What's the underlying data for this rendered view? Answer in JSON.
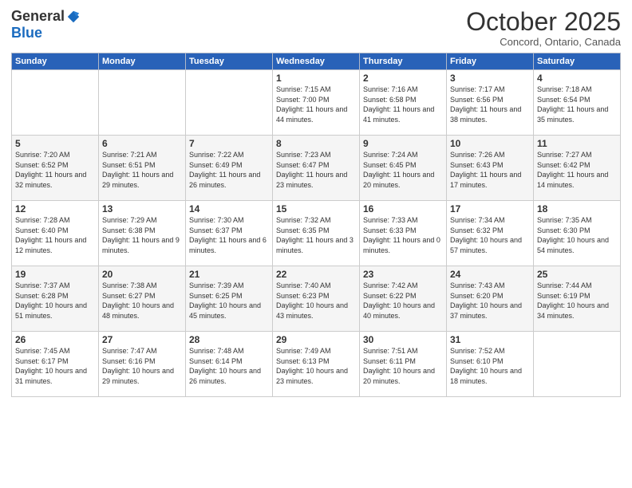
{
  "logo": {
    "general": "General",
    "blue": "Blue"
  },
  "header": {
    "month": "October 2025",
    "location": "Concord, Ontario, Canada"
  },
  "weekdays": [
    "Sunday",
    "Monday",
    "Tuesday",
    "Wednesday",
    "Thursday",
    "Friday",
    "Saturday"
  ],
  "weeks": [
    [
      {
        "day": "",
        "info": ""
      },
      {
        "day": "",
        "info": ""
      },
      {
        "day": "",
        "info": ""
      },
      {
        "day": "1",
        "info": "Sunrise: 7:15 AM\nSunset: 7:00 PM\nDaylight: 11 hours and 44 minutes."
      },
      {
        "day": "2",
        "info": "Sunrise: 7:16 AM\nSunset: 6:58 PM\nDaylight: 11 hours and 41 minutes."
      },
      {
        "day": "3",
        "info": "Sunrise: 7:17 AM\nSunset: 6:56 PM\nDaylight: 11 hours and 38 minutes."
      },
      {
        "day": "4",
        "info": "Sunrise: 7:18 AM\nSunset: 6:54 PM\nDaylight: 11 hours and 35 minutes."
      }
    ],
    [
      {
        "day": "5",
        "info": "Sunrise: 7:20 AM\nSunset: 6:52 PM\nDaylight: 11 hours and 32 minutes."
      },
      {
        "day": "6",
        "info": "Sunrise: 7:21 AM\nSunset: 6:51 PM\nDaylight: 11 hours and 29 minutes."
      },
      {
        "day": "7",
        "info": "Sunrise: 7:22 AM\nSunset: 6:49 PM\nDaylight: 11 hours and 26 minutes."
      },
      {
        "day": "8",
        "info": "Sunrise: 7:23 AM\nSunset: 6:47 PM\nDaylight: 11 hours and 23 minutes."
      },
      {
        "day": "9",
        "info": "Sunrise: 7:24 AM\nSunset: 6:45 PM\nDaylight: 11 hours and 20 minutes."
      },
      {
        "day": "10",
        "info": "Sunrise: 7:26 AM\nSunset: 6:43 PM\nDaylight: 11 hours and 17 minutes."
      },
      {
        "day": "11",
        "info": "Sunrise: 7:27 AM\nSunset: 6:42 PM\nDaylight: 11 hours and 14 minutes."
      }
    ],
    [
      {
        "day": "12",
        "info": "Sunrise: 7:28 AM\nSunset: 6:40 PM\nDaylight: 11 hours and 12 minutes."
      },
      {
        "day": "13",
        "info": "Sunrise: 7:29 AM\nSunset: 6:38 PM\nDaylight: 11 hours and 9 minutes."
      },
      {
        "day": "14",
        "info": "Sunrise: 7:30 AM\nSunset: 6:37 PM\nDaylight: 11 hours and 6 minutes."
      },
      {
        "day": "15",
        "info": "Sunrise: 7:32 AM\nSunset: 6:35 PM\nDaylight: 11 hours and 3 minutes."
      },
      {
        "day": "16",
        "info": "Sunrise: 7:33 AM\nSunset: 6:33 PM\nDaylight: 11 hours and 0 minutes."
      },
      {
        "day": "17",
        "info": "Sunrise: 7:34 AM\nSunset: 6:32 PM\nDaylight: 10 hours and 57 minutes."
      },
      {
        "day": "18",
        "info": "Sunrise: 7:35 AM\nSunset: 6:30 PM\nDaylight: 10 hours and 54 minutes."
      }
    ],
    [
      {
        "day": "19",
        "info": "Sunrise: 7:37 AM\nSunset: 6:28 PM\nDaylight: 10 hours and 51 minutes."
      },
      {
        "day": "20",
        "info": "Sunrise: 7:38 AM\nSunset: 6:27 PM\nDaylight: 10 hours and 48 minutes."
      },
      {
        "day": "21",
        "info": "Sunrise: 7:39 AM\nSunset: 6:25 PM\nDaylight: 10 hours and 45 minutes."
      },
      {
        "day": "22",
        "info": "Sunrise: 7:40 AM\nSunset: 6:23 PM\nDaylight: 10 hours and 43 minutes."
      },
      {
        "day": "23",
        "info": "Sunrise: 7:42 AM\nSunset: 6:22 PM\nDaylight: 10 hours and 40 minutes."
      },
      {
        "day": "24",
        "info": "Sunrise: 7:43 AM\nSunset: 6:20 PM\nDaylight: 10 hours and 37 minutes."
      },
      {
        "day": "25",
        "info": "Sunrise: 7:44 AM\nSunset: 6:19 PM\nDaylight: 10 hours and 34 minutes."
      }
    ],
    [
      {
        "day": "26",
        "info": "Sunrise: 7:45 AM\nSunset: 6:17 PM\nDaylight: 10 hours and 31 minutes."
      },
      {
        "day": "27",
        "info": "Sunrise: 7:47 AM\nSunset: 6:16 PM\nDaylight: 10 hours and 29 minutes."
      },
      {
        "day": "28",
        "info": "Sunrise: 7:48 AM\nSunset: 6:14 PM\nDaylight: 10 hours and 26 minutes."
      },
      {
        "day": "29",
        "info": "Sunrise: 7:49 AM\nSunset: 6:13 PM\nDaylight: 10 hours and 23 minutes."
      },
      {
        "day": "30",
        "info": "Sunrise: 7:51 AM\nSunset: 6:11 PM\nDaylight: 10 hours and 20 minutes."
      },
      {
        "day": "31",
        "info": "Sunrise: 7:52 AM\nSunset: 6:10 PM\nDaylight: 10 hours and 18 minutes."
      },
      {
        "day": "",
        "info": ""
      }
    ]
  ]
}
